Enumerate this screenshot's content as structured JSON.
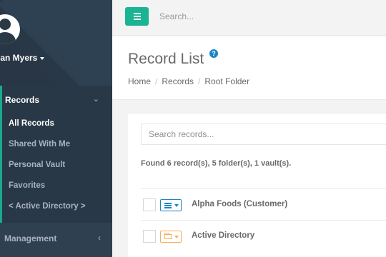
{
  "sidebar": {
    "username": "Ian Myers",
    "records_label": "Records",
    "records_chevron": "⌄",
    "items": [
      {
        "label": "All Records",
        "active": true
      },
      {
        "label": "Shared With Me",
        "active": false
      },
      {
        "label": "Personal Vault",
        "active": false
      },
      {
        "label": "Favorites",
        "active": false
      },
      {
        "label": "< Active Directory >",
        "active": false
      }
    ],
    "management_label": "Management",
    "management_chevron": "‹"
  },
  "topbar": {
    "search_placeholder": "Search..."
  },
  "heading": {
    "title": "Record List",
    "help": "?",
    "breadcrumb": [
      "Home",
      "Records",
      "Root Folder"
    ],
    "separator": "/"
  },
  "content": {
    "search_placeholder": "Search records...",
    "found_text": "Found 6 record(s), 5 folder(s), 1 vault(s).",
    "rows": [
      {
        "name": "Alpha Foods (Customer)",
        "type": "record",
        "icon": "list-icon"
      },
      {
        "name": "Active Directory",
        "type": "folder",
        "icon": "folder-icon"
      }
    ]
  },
  "colors": {
    "sidebar": "#2f4050",
    "accent": "#1ab394",
    "record_blue": "#1c84c6",
    "folder_orange": "#f8ac59"
  }
}
